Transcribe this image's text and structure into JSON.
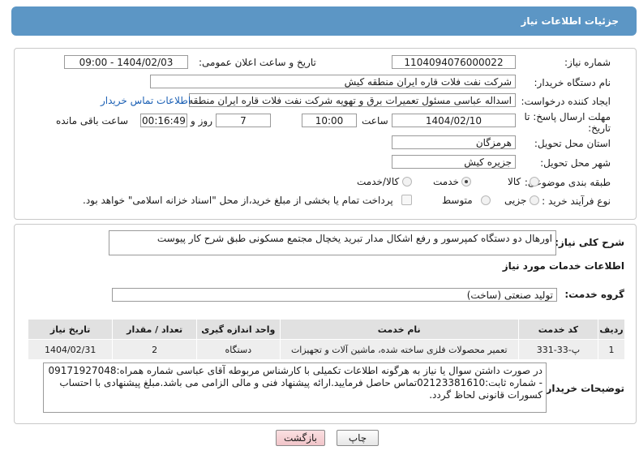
{
  "header": {
    "title": "جزئیات اطلاعات نیاز"
  },
  "form": {
    "need_number_label": "شماره نیاز:",
    "need_number": "1104094076000022",
    "announce_label": "تاریخ و ساعت اعلان عمومی:",
    "announce_value": "1404/02/03 - 09:00",
    "buyer_org_label": "نام دستگاه خریدار:",
    "buyer_org": "شرکت نفت فلات قاره ایران منطقه کیش",
    "creator_label": "ایجاد کننده درخواست:",
    "creator": "اسداله  عباسی  مسئول تعمیرات برق و تهویه  شرکت نفت فلات قاره ایران منطقه",
    "buyer_contact_link": "اطلاعات تماس خریدار",
    "deadline_label_1": "مهلت ارسال پاسخ: تا",
    "deadline_label_2": "تاریخ:",
    "deadline_date": "1404/02/10",
    "time_label": "ساعت",
    "deadline_time": "10:00",
    "days_value": "7",
    "days_label": "روز و",
    "remaining_time": "00:16:49",
    "remaining_label": "ساعت باقی مانده",
    "province_label": "استان محل تحویل:",
    "province": "هرمزگان",
    "city_label": "شهر محل تحویل:",
    "city": "جزیره کیش",
    "category_label": "طبقه بندی موضوعی:",
    "category_options": [
      "کالا",
      "خدمت",
      "کالا/خدمت"
    ],
    "process_label": "نوع فرآیند خرید :",
    "process_options": [
      "جزیی",
      "متوسط"
    ],
    "payment_note": "پرداخت تمام یا بخشی از مبلغ خرید،از محل \"اسناد خزانه اسلامی\" خواهد بود."
  },
  "summary": {
    "label": "شرح کلی نیاز:",
    "value": "اورهال دو دستگاه کمپرسور و رفع اشکال مدار تبرید یخچال مجتمع مسکونی طبق شرح کار پیوست"
  },
  "services": {
    "section_title": "اطلاعات خدمات مورد نیاز",
    "group_label": "گروه خدمت:",
    "group_value": "تولید صنعتی (ساخت)",
    "columns": [
      "ردیف",
      "کد خدمت",
      "نام خدمت",
      "واحد اندازه گیری",
      "تعداد / مقدار",
      "تاریخ نیاز"
    ],
    "rows": [
      [
        "1",
        "پ-33-331",
        "تعمیر محصولات فلزی ساخته شده، ماشین آلات و تجهیزات",
        "دستگاه",
        "2",
        "1404/02/31"
      ]
    ]
  },
  "buyer_notes": {
    "label": "توضیحات خریدار:",
    "value": "در صورت داشتن سوال یا نیاز به هرگونه اطلاعات تکمیلی با کارشناس مربوطه آقای عباسی شماره همراه:09171927048 - شماره ثابت:02123381610تماس حاصل فرمایید.ارائه پیشنهاد فنی و مالی الزامی می باشد.مبلغ  پیشنهادی با احتساب کسورات قانونی لحاظ گردد."
  },
  "buttons": {
    "print": "چاپ",
    "back": "بازگشت"
  },
  "colors": {
    "header_bg": "#5c96c5",
    "link": "#1a5fb4",
    "back_button": "#f1c5c9"
  }
}
